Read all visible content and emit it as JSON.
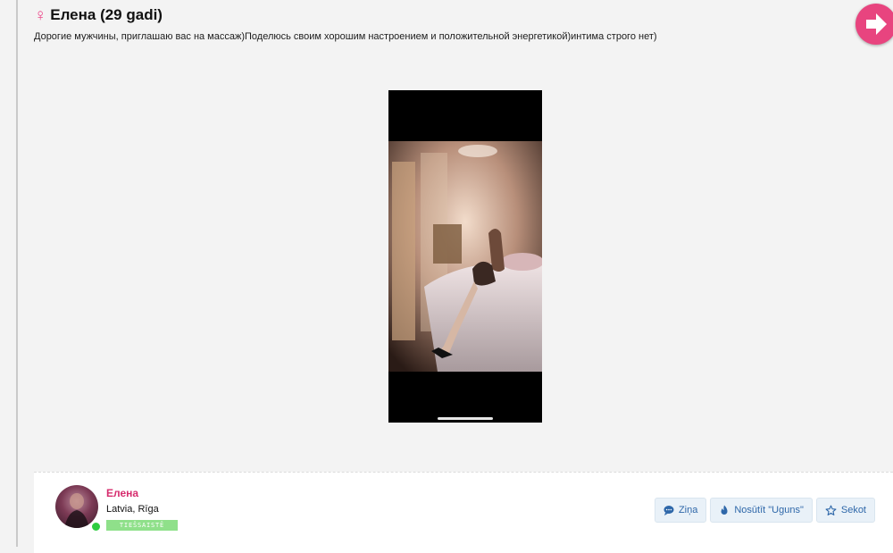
{
  "post": {
    "title": "Елена (29 gadi)",
    "gender_icon": "venus-icon",
    "description": "Дорогие мужчины, приглашаю вас на массаж)Поделюсь своим хорошим настроением и положительной энергетикой)интима строго нет)",
    "next_icon": "arrow-right-circle-icon",
    "photo_icon": "photo-image"
  },
  "profile": {
    "name": "Елена",
    "location": "Latvia, Rīga",
    "status": "TIEŠSAISTĒ",
    "online_color": "#2ecc40"
  },
  "actions": {
    "message_label": "Ziņa",
    "fire_label": "Nosūtīt \"Uguns\"",
    "follow_label": "Sekot"
  },
  "colors": {
    "accent_pink": "#e8447f",
    "name_pink": "#d62d6e",
    "button_text": "#2e67a9",
    "button_bg": "#e9f1f8",
    "status_green": "#8fe08a"
  }
}
